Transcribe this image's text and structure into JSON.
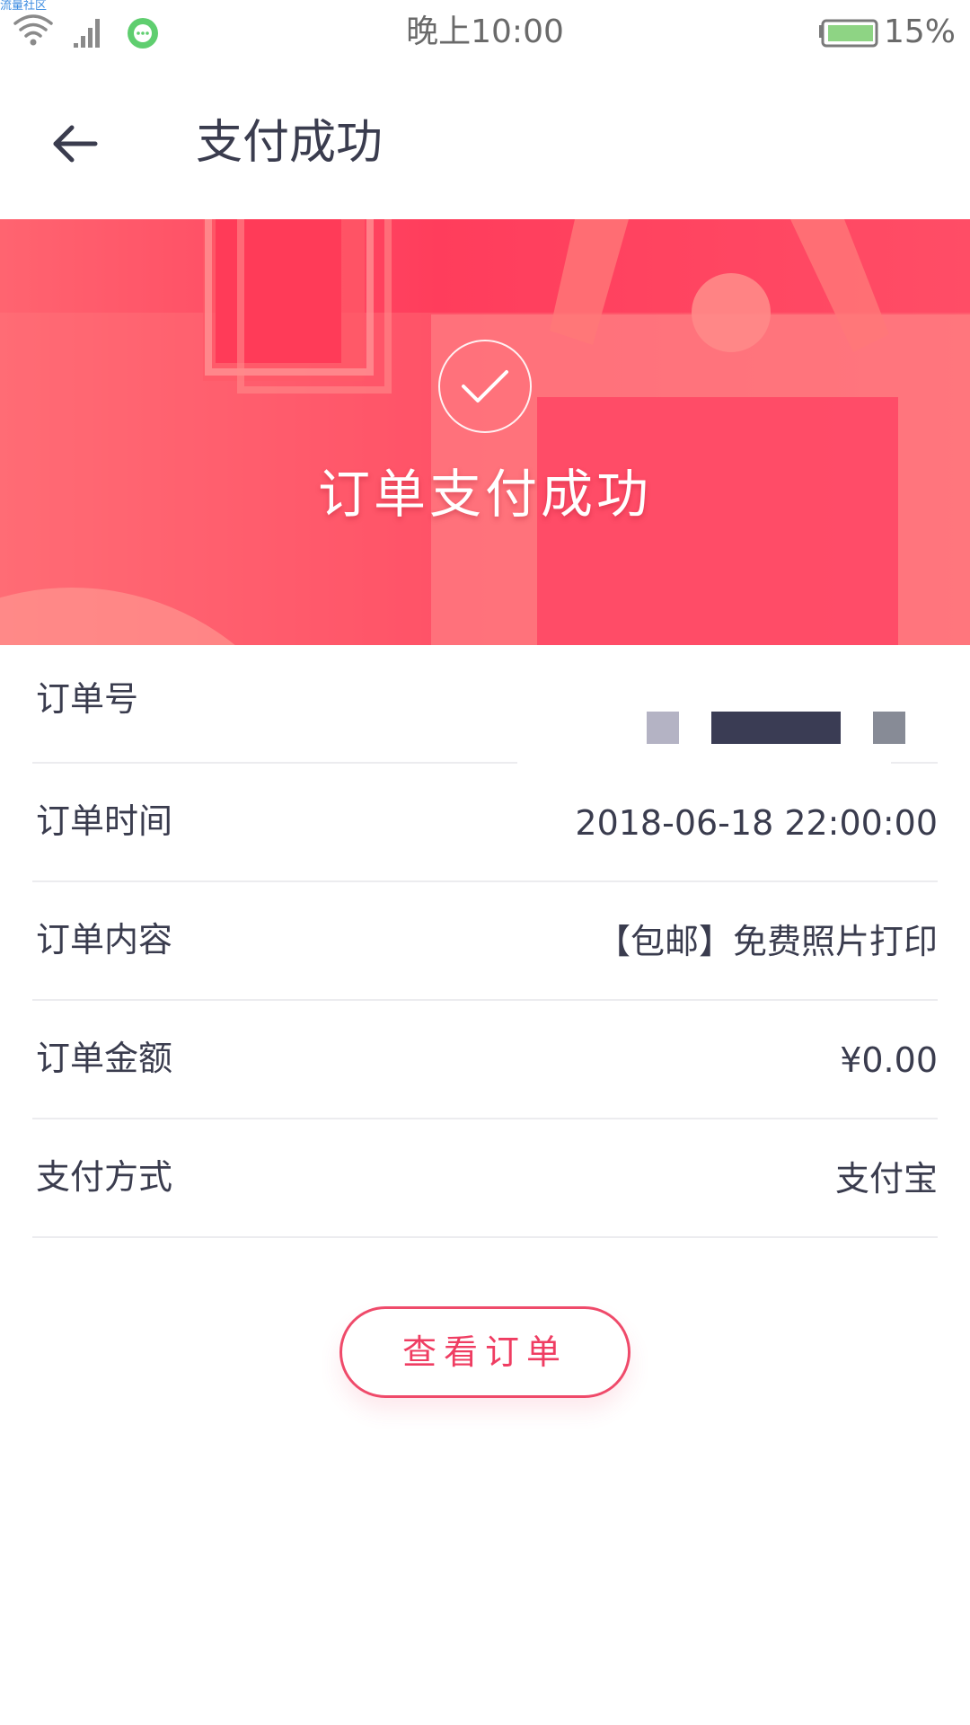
{
  "watermark": "流量社区",
  "status_bar": {
    "time": "晚上10:00",
    "battery": "15%"
  },
  "header": {
    "title": "支付成功"
  },
  "banner": {
    "title": "订单支付成功"
  },
  "order_info": {
    "rows": [
      {
        "label": "订单号",
        "value": ""
      },
      {
        "label": "订单时间",
        "value": "2018-06-18  22:00:00"
      },
      {
        "label": "订单内容",
        "value": "【包邮】免费照片打印"
      },
      {
        "label": "订单金额",
        "value": "¥0.00"
      },
      {
        "label": "支付方式",
        "value": "支付宝"
      }
    ]
  },
  "actions": {
    "view_order_label": "查看订单"
  },
  "colors": {
    "accent": "#ef3d62",
    "banner_start": "#ff6470",
    "banner_end": "#ff4d66",
    "text": "#3a3c4e"
  }
}
